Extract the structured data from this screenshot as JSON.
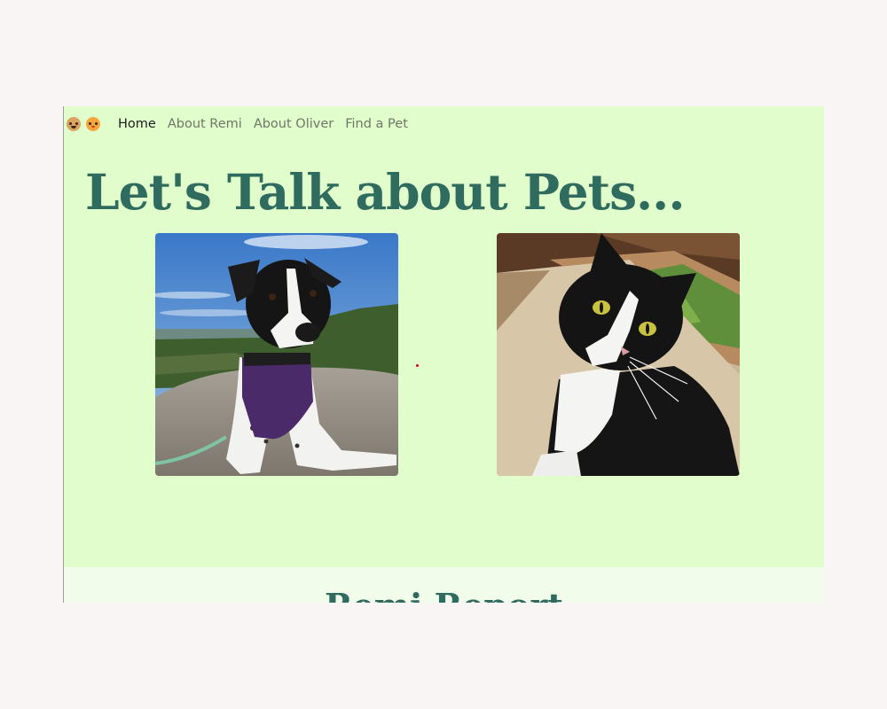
{
  "brand": {
    "icons": [
      "dog-face-icon",
      "cat-face-icon"
    ]
  },
  "nav": {
    "items": [
      {
        "label": "Home",
        "active": true
      },
      {
        "label": "About Remi",
        "active": false
      },
      {
        "label": "About Oliver",
        "active": false
      },
      {
        "label": "Find a Pet",
        "active": false
      }
    ]
  },
  "hero": {
    "title": "Let's Talk about Pets..."
  },
  "photos": {
    "remi": {
      "alt": "Remi the dog"
    },
    "oliver": {
      "alt": "Oliver the cat"
    }
  },
  "next_section": {
    "title": "Remi Report"
  },
  "colors": {
    "page_bg": "#f9f5f4",
    "hero_bg": "#e1fdcb",
    "section_bg": "#f1fdea",
    "heading": "#2f6b5e",
    "nav_inactive": "#6d7868",
    "nav_active": "#1c1c1c"
  }
}
